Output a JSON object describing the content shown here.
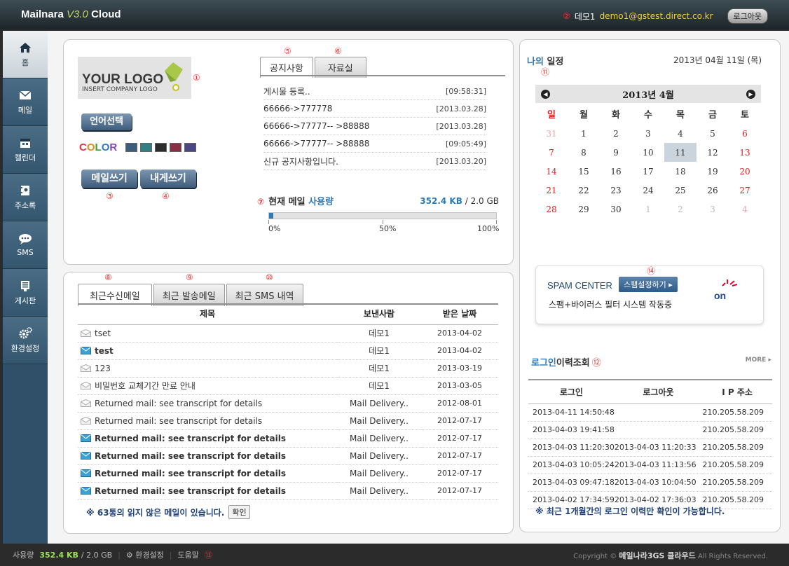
{
  "brand": {
    "name": "Mailnara",
    "version": "V3.0",
    "suffix": "Cloud"
  },
  "header": {
    "marker": "②",
    "user": "데모1",
    "email": "demo1@gstest.direct.co.kr",
    "logout": "로그아웃"
  },
  "sidebar": {
    "items": [
      {
        "label": "홈",
        "icon": "home-icon"
      },
      {
        "label": "메일",
        "icon": "mail-icon"
      },
      {
        "label": "캘린더",
        "icon": "calendar-icon"
      },
      {
        "label": "주소록",
        "icon": "address-book-icon"
      },
      {
        "label": "SMS",
        "icon": "chat-icon"
      },
      {
        "label": "게시판",
        "icon": "board-icon"
      },
      {
        "label": "환경설정",
        "icon": "gear-icon"
      }
    ]
  },
  "profile": {
    "logo_title": "YOUR LOGO",
    "logo_sub": "INSERT COMPANY LOGO",
    "marker_logo": "①",
    "lang_btn": "언어선택",
    "color_label": "COLOR",
    "swatches": [
      "#3d5d7b",
      "#2f7f84",
      "#2c2c2c",
      "#8a2e46",
      "#4b4782"
    ],
    "compose_btn": "메일쓰기",
    "self_btn": "내게쓰기",
    "marker_compose": "③",
    "marker_self": "④"
  },
  "notice": {
    "markers": [
      "⑤",
      "⑥"
    ],
    "tabs": [
      "공지사항",
      "자료실"
    ],
    "items": [
      {
        "title": "게시물 등록..",
        "date": "[09:58:31]"
      },
      {
        "title": "66666->777778",
        "date": "[2013.03.28]"
      },
      {
        "title": "66666->77777-- >88888",
        "date": "[2013.03.28]"
      },
      {
        "title": "66666->77777-- >88888",
        "date": "[09:05:49]"
      },
      {
        "title": "신규 공지사항입니다.",
        "date": "[2013.03.20]"
      }
    ]
  },
  "usage": {
    "marker": "⑦",
    "label_a": "현재 메일 ",
    "label_b": "사용량",
    "used": "352.4 KB",
    "total": " / 2.0 GB",
    "percent": 0.02,
    "ticks": [
      "0%",
      "50%",
      "100%"
    ]
  },
  "recent": {
    "markers": [
      "⑧",
      "⑨",
      "⑩"
    ],
    "tabs": [
      "최근수신메일",
      "최근 발송메일",
      "최근 SMS 내역"
    ],
    "columns": [
      "제목",
      "보낸사람",
      "받은 날짜"
    ],
    "rows": [
      {
        "subject": "tset",
        "sender": "데모1",
        "date": "2013-04-02",
        "unread": false
      },
      {
        "subject": "test",
        "sender": "데모1",
        "date": "2013-04-02",
        "unread": true
      },
      {
        "subject": "123",
        "sender": "데모1",
        "date": "2013-03-19",
        "unread": false
      },
      {
        "subject": "비밀번호 교체기간 만료 안내",
        "sender": "데모1",
        "date": "2013-03-05",
        "unread": false
      },
      {
        "subject": "Returned mail: see transcript for details",
        "sender": "Mail Delivery..",
        "date": "2012-08-01",
        "unread": false
      },
      {
        "subject": "Returned mail: see transcript for details",
        "sender": "Mail Delivery..",
        "date": "2012-07-17",
        "unread": false
      },
      {
        "subject": "Returned mail: see transcript for details",
        "sender": "Mail Delivery..",
        "date": "2012-07-17",
        "unread": true
      },
      {
        "subject": "Returned mail: see transcript for details",
        "sender": "Mail Delivery..",
        "date": "2012-07-17",
        "unread": true
      },
      {
        "subject": "Returned mail: see transcript for details",
        "sender": "Mail Delivery..",
        "date": "2012-07-17",
        "unread": true
      },
      {
        "subject": "Returned mail: see transcript for details",
        "sender": "Mail Delivery..",
        "date": "2012-07-17",
        "unread": true
      }
    ],
    "note": "※ 63통의 읽지 않은 메일이 있습니다.",
    "confirm": "확인"
  },
  "schedule": {
    "title_a": "나의",
    "title_b": " 일정",
    "marker": "⑪",
    "today": "2013년 04월 11일 (목)",
    "month": "2013년 4월",
    "dow": [
      "일",
      "월",
      "화",
      "수",
      "목",
      "금",
      "토"
    ],
    "weeks": [
      [
        "31",
        "1",
        "2",
        "3",
        "4",
        "5",
        "6"
      ],
      [
        "7",
        "8",
        "9",
        "10",
        "11",
        "12",
        "13"
      ],
      [
        "14",
        "15",
        "16",
        "17",
        "18",
        "19",
        "20"
      ],
      [
        "21",
        "22",
        "23",
        "24",
        "25",
        "26",
        "27"
      ],
      [
        "28",
        "29",
        "30",
        "1",
        "2",
        "3",
        "4"
      ]
    ]
  },
  "spam": {
    "title": "SPAM CENTER",
    "button": "스팸설정하기 ▸",
    "marker": "⑭",
    "desc": "스팸+바이러스 필터 시스템 작동중",
    "status": "on"
  },
  "login_history": {
    "title_a": "로그인",
    "title_b": "이력조회",
    "marker": "⑫",
    "more": "MORE",
    "columns": [
      "로그인",
      "로그아웃",
      "I P 주소"
    ],
    "rows": [
      [
        "2013-04-11 14:50:48",
        "",
        "210.205.58.209"
      ],
      [
        "2013-04-03 19:41:58",
        "",
        "210.205.58.209"
      ],
      [
        "2013-04-03 11:20:30",
        "2013-04-03 11:20:33",
        "210.205.58.209"
      ],
      [
        "2013-04-03 10:05:24",
        "2013-04-03 11:13:56",
        "210.205.58.209"
      ],
      [
        "2013-04-03 09:47:18",
        "2013-04-03 10:04:50",
        "210.205.58.209"
      ],
      [
        "2013-04-02 17:34:59",
        "2013-04-02 17:36:03",
        "210.205.58.209"
      ]
    ],
    "note": "※ 최근 1개월간의 로그인 이력만 확인이 가능합니다."
  },
  "footer": {
    "usage_label": "사용량",
    "used": "352.4 KB",
    "total": "/ 2.0 GB",
    "settings": "환경설정",
    "help": "도움말",
    "marker": "⑬",
    "copyright_a": "Copyright © ",
    "copyright_b": "메일나라3GS 클라우드",
    "copyright_c": " All Rights Reserved."
  }
}
